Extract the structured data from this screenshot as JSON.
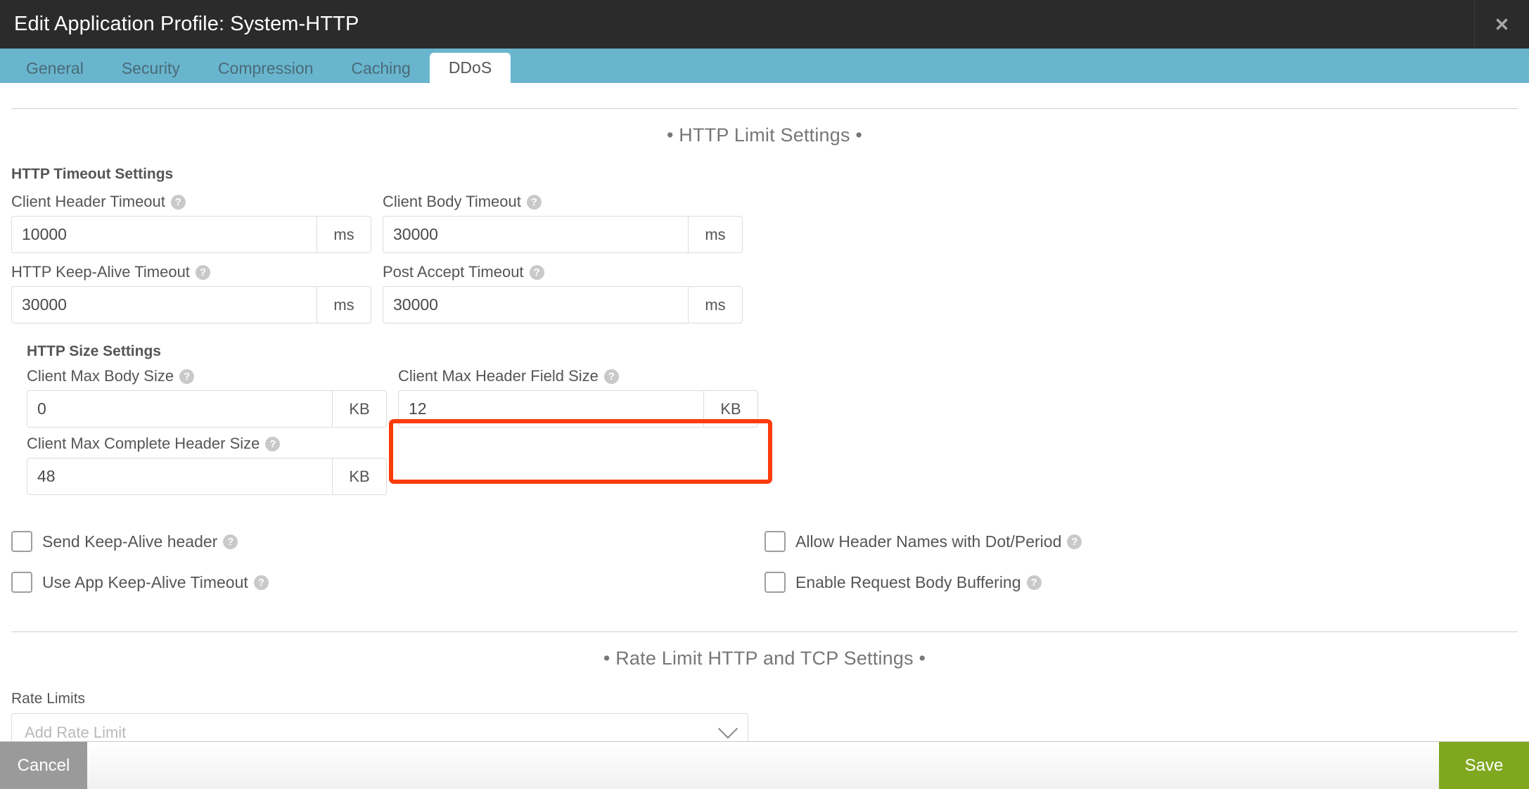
{
  "titlebar": {
    "title": "Edit Application Profile: System-HTTP",
    "close_label": "✕"
  },
  "tabs": [
    {
      "label": "General",
      "active": false
    },
    {
      "label": "Security",
      "active": false
    },
    {
      "label": "Compression",
      "active": false
    },
    {
      "label": "Caching",
      "active": false
    },
    {
      "label": "DDoS",
      "active": true
    }
  ],
  "sections": {
    "http_limit": {
      "heading": "• HTTP Limit Settings •"
    },
    "rate_limit": {
      "heading": "• Rate Limit HTTP and TCP Settings •"
    }
  },
  "timeout_group": {
    "title": "HTTP Timeout Settings",
    "fields": [
      {
        "label": "Client Header Timeout",
        "value": "10000",
        "unit": "ms",
        "help": "?"
      },
      {
        "label": "Client Body Timeout",
        "value": "30000",
        "unit": "ms",
        "help": "?"
      },
      {
        "label": "HTTP Keep-Alive Timeout",
        "value": "30000",
        "unit": "ms",
        "help": "?"
      },
      {
        "label": "Post Accept Timeout",
        "value": "30000",
        "unit": "ms",
        "help": "?"
      }
    ]
  },
  "size_group": {
    "title": "HTTP Size Settings",
    "fields": [
      {
        "label": "Client Max Body Size",
        "value": "0",
        "unit": "KB",
        "help": "?"
      },
      {
        "label": "Client Max Header Field Size",
        "value": "12",
        "unit": "KB",
        "help": "?",
        "highlighted": true
      },
      {
        "label": "Client Max Complete Header Size",
        "value": "48",
        "unit": "KB",
        "help": "?"
      }
    ]
  },
  "checkboxes": {
    "left": [
      {
        "label": "Send Keep-Alive header",
        "checked": false,
        "help": "?"
      },
      {
        "label": "Use App Keep-Alive Timeout",
        "checked": false,
        "help": "?"
      }
    ],
    "right": [
      {
        "label": "Allow Header Names with Dot/Period",
        "checked": false,
        "help": "?"
      },
      {
        "label": "Enable Request Body Buffering",
        "checked": false,
        "help": "?"
      }
    ]
  },
  "rate_limits": {
    "label": "Rate Limits",
    "placeholder": "Add Rate Limit",
    "value": ""
  },
  "footer": {
    "cancel_label": "Cancel",
    "save_label": "Save"
  },
  "colors": {
    "titlebar_bg": "#2b2b2b",
    "tabbar_bg": "#69b5ce",
    "active_tab_bg": "#ffffff",
    "highlight_border": "#fb3b0a",
    "save_bg": "#7fa81f",
    "cancel_bg": "#9a9a9a",
    "text": "#555555"
  }
}
